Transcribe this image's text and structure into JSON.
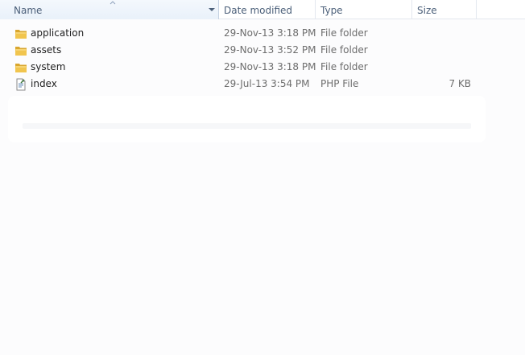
{
  "columns": {
    "name": "Name",
    "date": "Date modified",
    "type": "Type",
    "size": "Size"
  },
  "sort": {
    "column": "name",
    "direction": "ascending",
    "arrow_icon": "sort-ascending-icon"
  },
  "files": [
    {
      "name": "application",
      "date": "29-Nov-13 3:18 PM",
      "type": "File folder",
      "size": "",
      "icon": "folder-icon"
    },
    {
      "name": "assets",
      "date": "29-Nov-13 3:52 PM",
      "type": "File folder",
      "size": "",
      "icon": "folder-icon"
    },
    {
      "name": "system",
      "date": "29-Nov-13 3:18 PM",
      "type": "File folder",
      "size": "",
      "icon": "folder-icon"
    },
    {
      "name": "index",
      "date": "29-Jul-13 3:54 PM",
      "type": "PHP File",
      "size": "7 KB",
      "icon": "php-file-icon"
    }
  ],
  "colors": {
    "header_text": "#4c607a",
    "secondary_text": "#6d6d6d",
    "folder_yellow": "#e8b83c"
  }
}
